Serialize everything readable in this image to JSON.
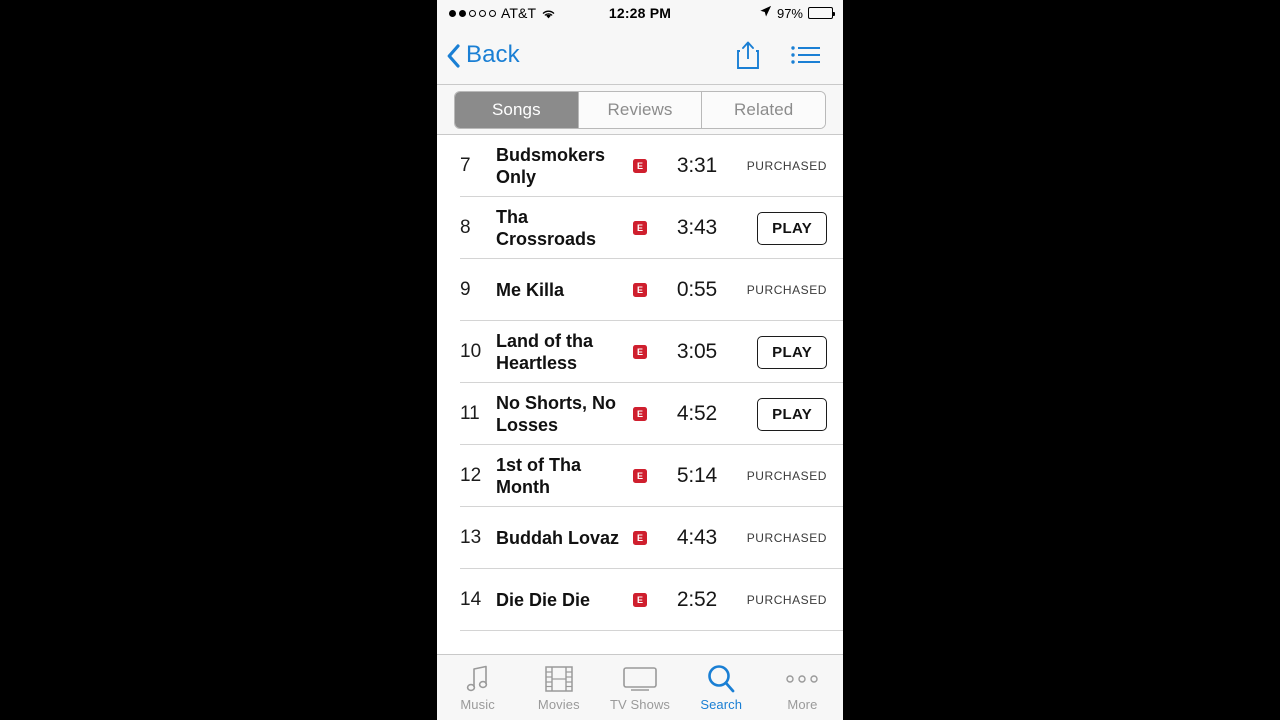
{
  "status_bar": {
    "signal_filled": 2,
    "signal_total": 5,
    "carrier": "AT&T",
    "wifi_icon": "wifi-icon",
    "time": "12:28 PM",
    "location_icon": "location-arrow-icon",
    "battery_percent": "97%",
    "battery_level": 97
  },
  "nav_bar": {
    "back_label": "Back",
    "back_icon": "chevron-left-icon",
    "share_icon": "share-icon",
    "list_icon": "list-icon",
    "accent_color": "#1a7fd4"
  },
  "segmented_control": {
    "options": [
      {
        "label": "Songs",
        "selected": true
      },
      {
        "label": "Reviews",
        "selected": false
      },
      {
        "label": "Related",
        "selected": false
      }
    ],
    "selected_color": "#8b8b8b"
  },
  "songs": {
    "explicit_badge_label": "E",
    "explicit_badge_color": "#cf1f2e",
    "purchased_label": "PURCHASED",
    "play_label": "PLAY",
    "rows": [
      {
        "number": "7",
        "title": "Budsmokers Only",
        "explicit": true,
        "duration": "3:31",
        "action": "purchased"
      },
      {
        "number": "8",
        "title": "Tha Crossroads",
        "explicit": true,
        "duration": "3:43",
        "action": "play"
      },
      {
        "number": "9",
        "title": "Me Killa",
        "explicit": true,
        "duration": "0:55",
        "action": "purchased"
      },
      {
        "number": "10",
        "title": "Land of tha Heartless",
        "explicit": true,
        "duration": "3:05",
        "action": "play"
      },
      {
        "number": "11",
        "title": "No Shorts, No Losses",
        "explicit": true,
        "duration": "4:52",
        "action": "play"
      },
      {
        "number": "12",
        "title": "1st of Tha Month",
        "explicit": true,
        "duration": "5:14",
        "action": "purchased"
      },
      {
        "number": "13",
        "title": "Buddah Lovaz",
        "explicit": true,
        "duration": "4:43",
        "action": "purchased"
      },
      {
        "number": "14",
        "title": "Die Die Die",
        "explicit": true,
        "duration": "2:52",
        "action": "purchased"
      }
    ]
  },
  "tab_bar": {
    "active_color": "#1a7fd4",
    "inactive_color": "#9a9a9a",
    "tabs": [
      {
        "label": "Music",
        "icon": "music-note-icon",
        "active": false
      },
      {
        "label": "Movies",
        "icon": "film-strip-icon",
        "active": false
      },
      {
        "label": "TV Shows",
        "icon": "monitor-icon",
        "active": false
      },
      {
        "label": "Search",
        "icon": "search-icon",
        "active": true
      },
      {
        "label": "More",
        "icon": "ellipsis-icon",
        "active": false
      }
    ]
  }
}
